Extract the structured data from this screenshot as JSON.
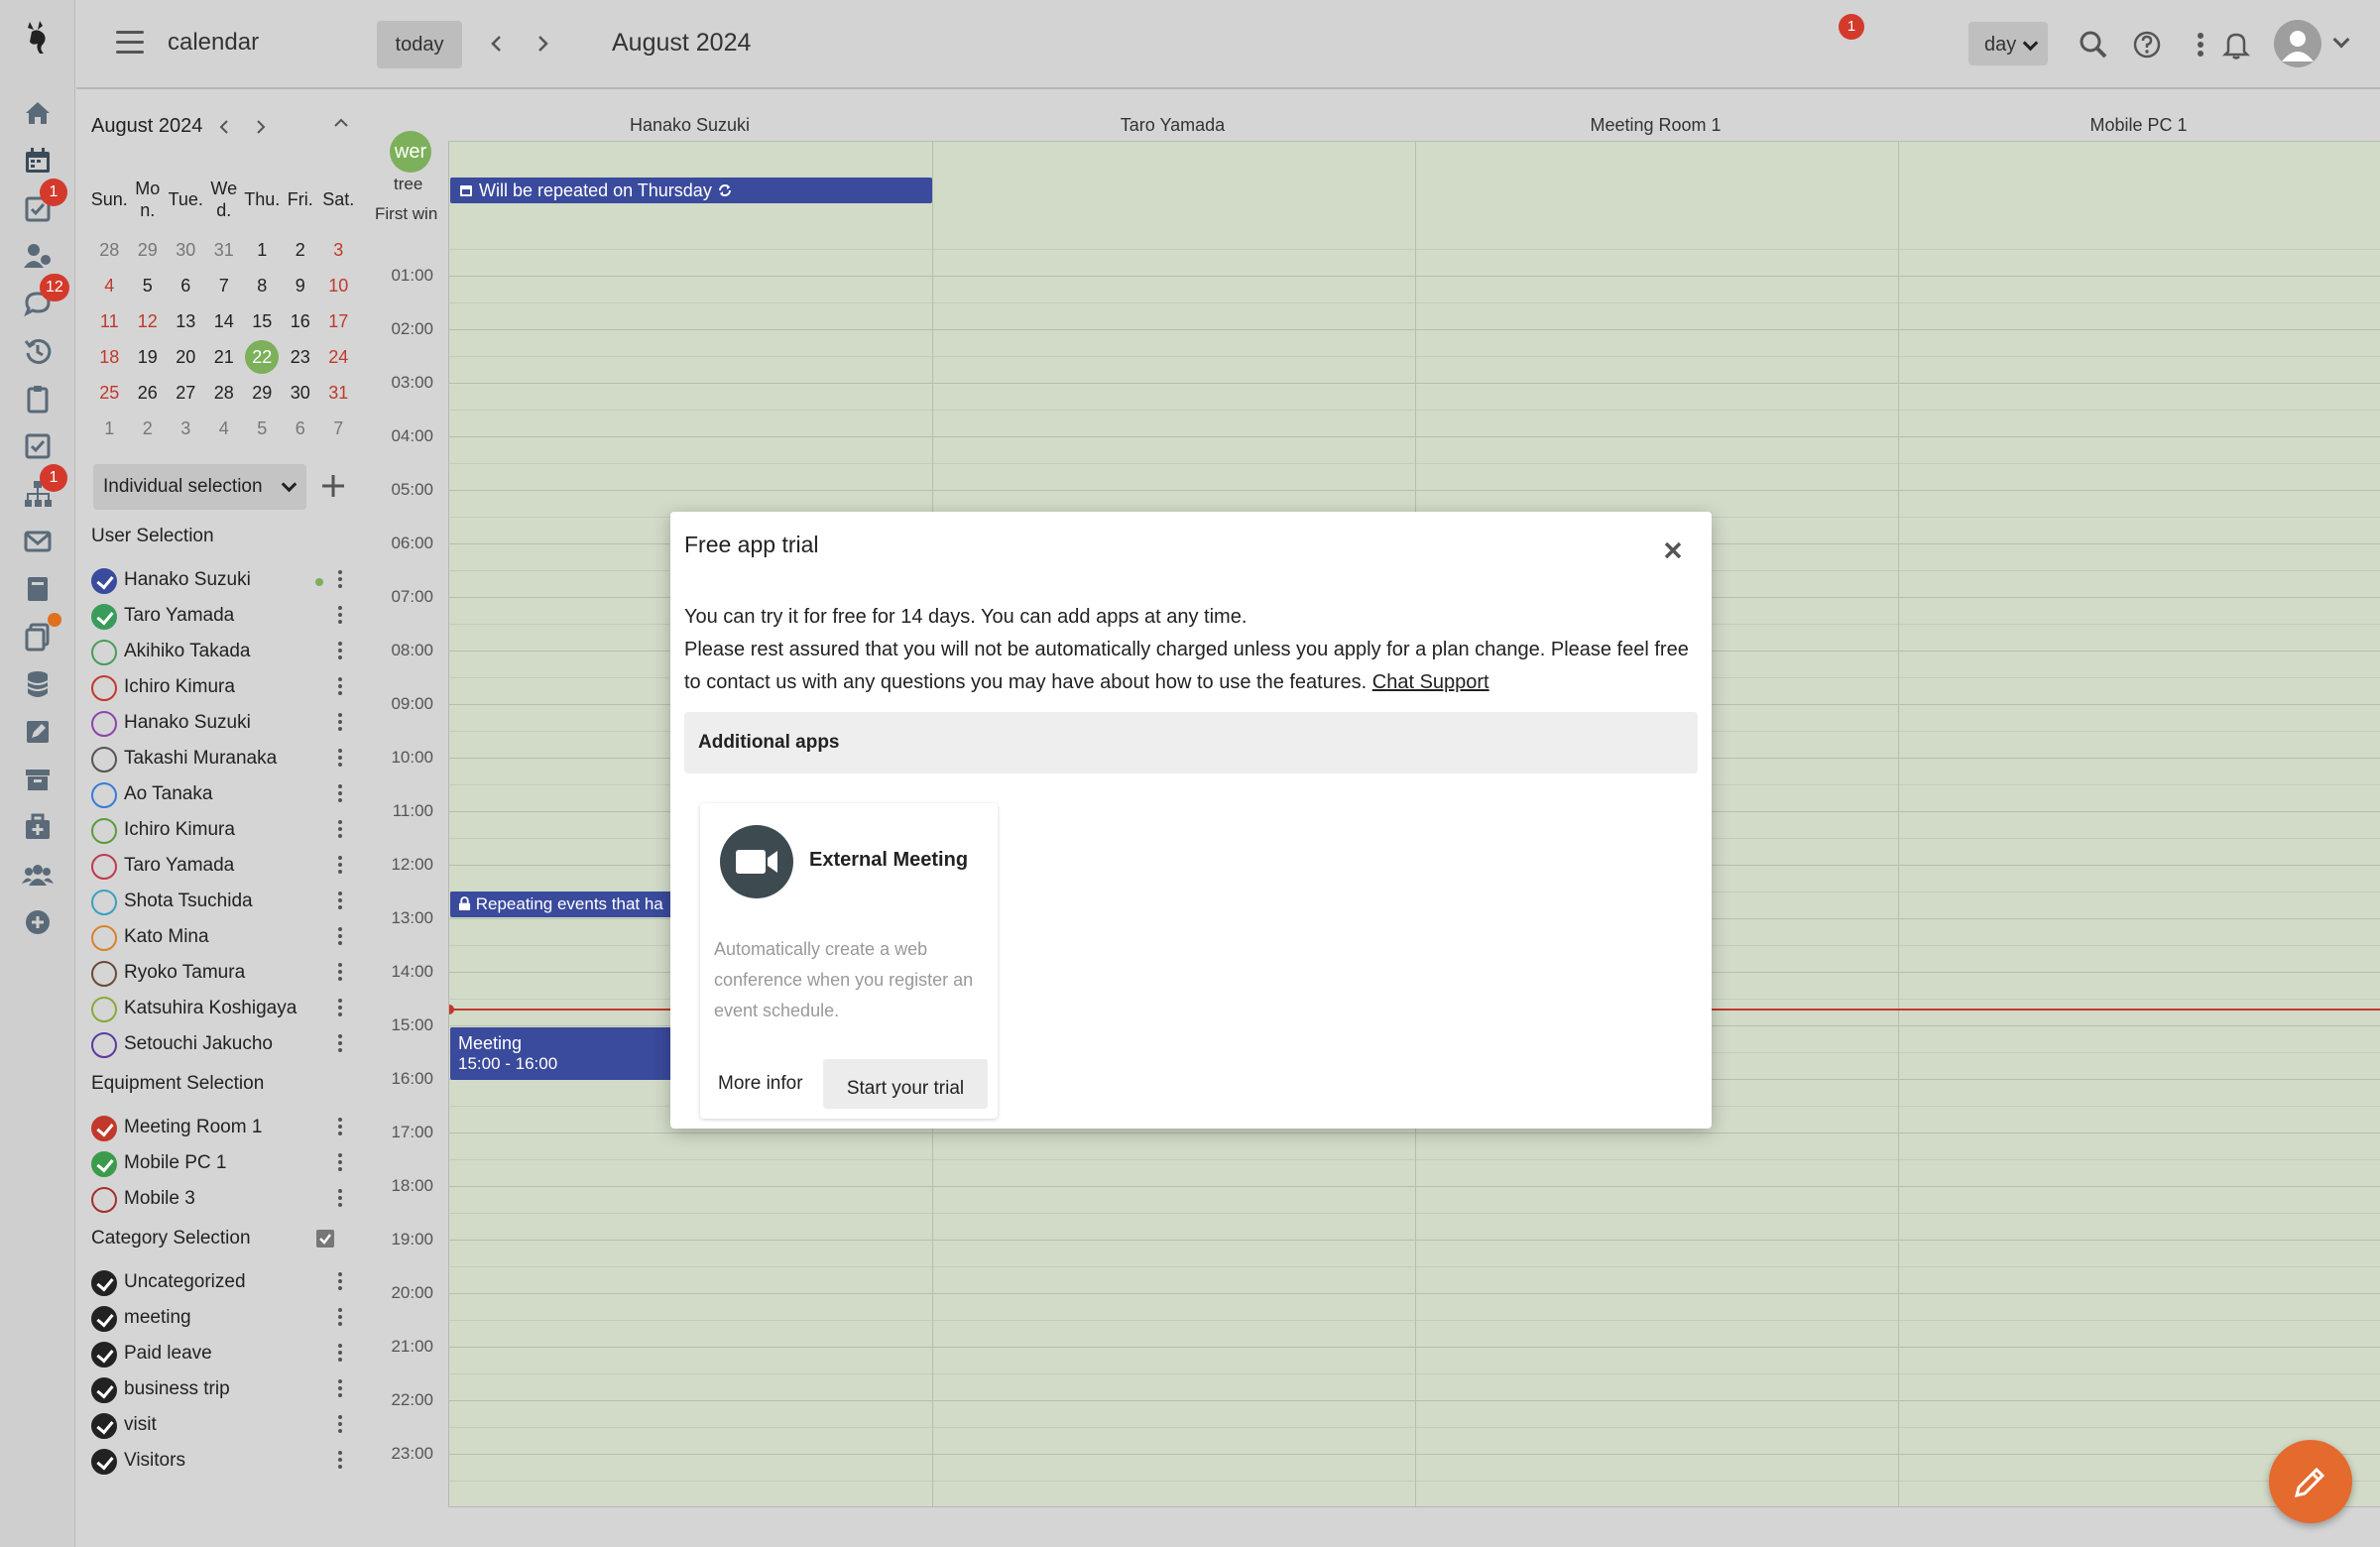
{
  "topbar": {
    "app_title": "calendar",
    "today_label": "today",
    "period": "August 2024",
    "view_mode": "day",
    "notification_count": "1"
  },
  "rail": {
    "icons": [
      "home-icon",
      "calendar-icon",
      "task-check-icon",
      "users-icon",
      "chat-icon",
      "history-icon",
      "clipboard-icon",
      "checkbox-icon",
      "org-chart-icon",
      "mail-icon",
      "book-icon",
      "files-icon",
      "database-icon",
      "edit-icon",
      "archive-icon",
      "medkit-icon",
      "group-icon",
      "add-circle-icon"
    ],
    "badges": {
      "task": "1",
      "chat": "12",
      "org": "1"
    }
  },
  "mini_calendar": {
    "title": "August 2024",
    "dow": [
      "Sun.",
      "Mo n.",
      "Tue.",
      "We d.",
      "Thu.",
      "Fri.",
      "Sat."
    ],
    "weeks": [
      [
        "28",
        "29",
        "30",
        "31",
        "1",
        "2",
        "3"
      ],
      [
        "4",
        "5",
        "6",
        "7",
        "8",
        "9",
        "10"
      ],
      [
        "11",
        "12",
        "13",
        "14",
        "15",
        "16",
        "17"
      ],
      [
        "18",
        "19",
        "20",
        "21",
        "22",
        "23",
        "24"
      ],
      [
        "25",
        "26",
        "27",
        "28",
        "29",
        "30",
        "31"
      ],
      [
        "1",
        "2",
        "3",
        "4",
        "5",
        "6",
        "7"
      ]
    ]
  },
  "sidebar": {
    "selection_mode": "Individual selection",
    "user_section": "User Selection",
    "users": [
      {
        "name": "Hanako Suzuki",
        "checked": true,
        "color": "#3a4a9c",
        "online": true
      },
      {
        "name": "Taro Yamada",
        "checked": true,
        "color": "#3a9c5a"
      },
      {
        "name": "Akihiko Takada",
        "checked": false,
        "color": "#4a9c5a"
      },
      {
        "name": "Ichiro Kimura",
        "checked": false,
        "color": "#c0392b"
      },
      {
        "name": "Hanako Suzuki",
        "checked": false,
        "color": "#8e44ad"
      },
      {
        "name": "Takashi Muranaka",
        "checked": false,
        "color": "#555555"
      },
      {
        "name": "Ao Tanaka",
        "checked": false,
        "color": "#3a7bd5"
      },
      {
        "name": "Ichiro Kimura",
        "checked": false,
        "color": "#5a9c3a"
      },
      {
        "name": "Taro Yamada",
        "checked": false,
        "color": "#c0394f"
      },
      {
        "name": "Shota Tsuchida",
        "checked": false,
        "color": "#3aa0c0"
      },
      {
        "name": "Kato Mina",
        "checked": false,
        "color": "#d9822b"
      },
      {
        "name": "Ryoko Tamura",
        "checked": false,
        "color": "#6b4a3a"
      },
      {
        "name": "Katsuhira Koshigaya",
        "checked": false,
        "color": "#8aa83a"
      },
      {
        "name": "Setouchi Jakucho",
        "checked": false,
        "color": "#5a3aa0"
      }
    ],
    "equipment_section": "Equipment Selection",
    "equipment": [
      {
        "name": "Meeting Room 1",
        "checked": true,
        "color": "#c0392b"
      },
      {
        "name": "Mobile PC 1",
        "checked": true,
        "color": "#3a9c4a"
      },
      {
        "name": "Mobile 3",
        "checked": false,
        "color": "#a0302b"
      }
    ],
    "category_section": "Category Selection",
    "categories": [
      {
        "name": "Uncategorized",
        "checked": true,
        "color": "#222222"
      },
      {
        "name": "meeting",
        "checked": true,
        "color": "#222222"
      },
      {
        "name": "Paid leave",
        "checked": true,
        "color": "#222222"
      },
      {
        "name": "business trip",
        "checked": true,
        "color": "#222222"
      },
      {
        "name": "visit",
        "checked": true,
        "color": "#222222"
      },
      {
        "name": "Visitors",
        "checked": true,
        "color": "#222222"
      }
    ]
  },
  "calendar": {
    "columns": [
      "Hanako Suzuki",
      "Taro Yamada",
      "Meeting Room 1",
      "Mobile PC 1"
    ],
    "allday_avatar": "wer",
    "allday_label": "tree",
    "allday_label2": "First win",
    "times": [
      "01:00",
      "02:00",
      "03:00",
      "04:00",
      "05:00",
      "06:00",
      "07:00",
      "08:00",
      "09:00",
      "10:00",
      "11:00",
      "12:00",
      "13:00",
      "14:00",
      "15:00",
      "16:00",
      "17:00",
      "18:00",
      "19:00",
      "20:00",
      "21:00",
      "22:00",
      "23:00"
    ],
    "events": {
      "allday": "Will be repeated on Thursday",
      "repeating": "Repeating events that ha",
      "meeting_title": "Meeting",
      "meeting_time": "15:00 - 16:00"
    },
    "colors": {
      "event": "#3a4a9c",
      "now_line": "#c0392b",
      "grid_bg": "#d2dbc8"
    }
  },
  "modal": {
    "title": "Free app trial",
    "line1": "You can try it for free for 14 days. You can add apps at any time.",
    "line2": "Please rest assured that you will not be automatically charged unless you apply for a plan change. Please feel free to contact us with any questions you may have about how to use the features.",
    "link": "Chat Support",
    "section": "Additional apps",
    "card": {
      "title": "External Meeting",
      "icon": "video-camera-icon",
      "description": "Automatically create a web conference when you register an event schedule.",
      "more": "More infor",
      "trial": "Start your trial"
    }
  },
  "fab": {
    "icon": "pencil-icon"
  }
}
